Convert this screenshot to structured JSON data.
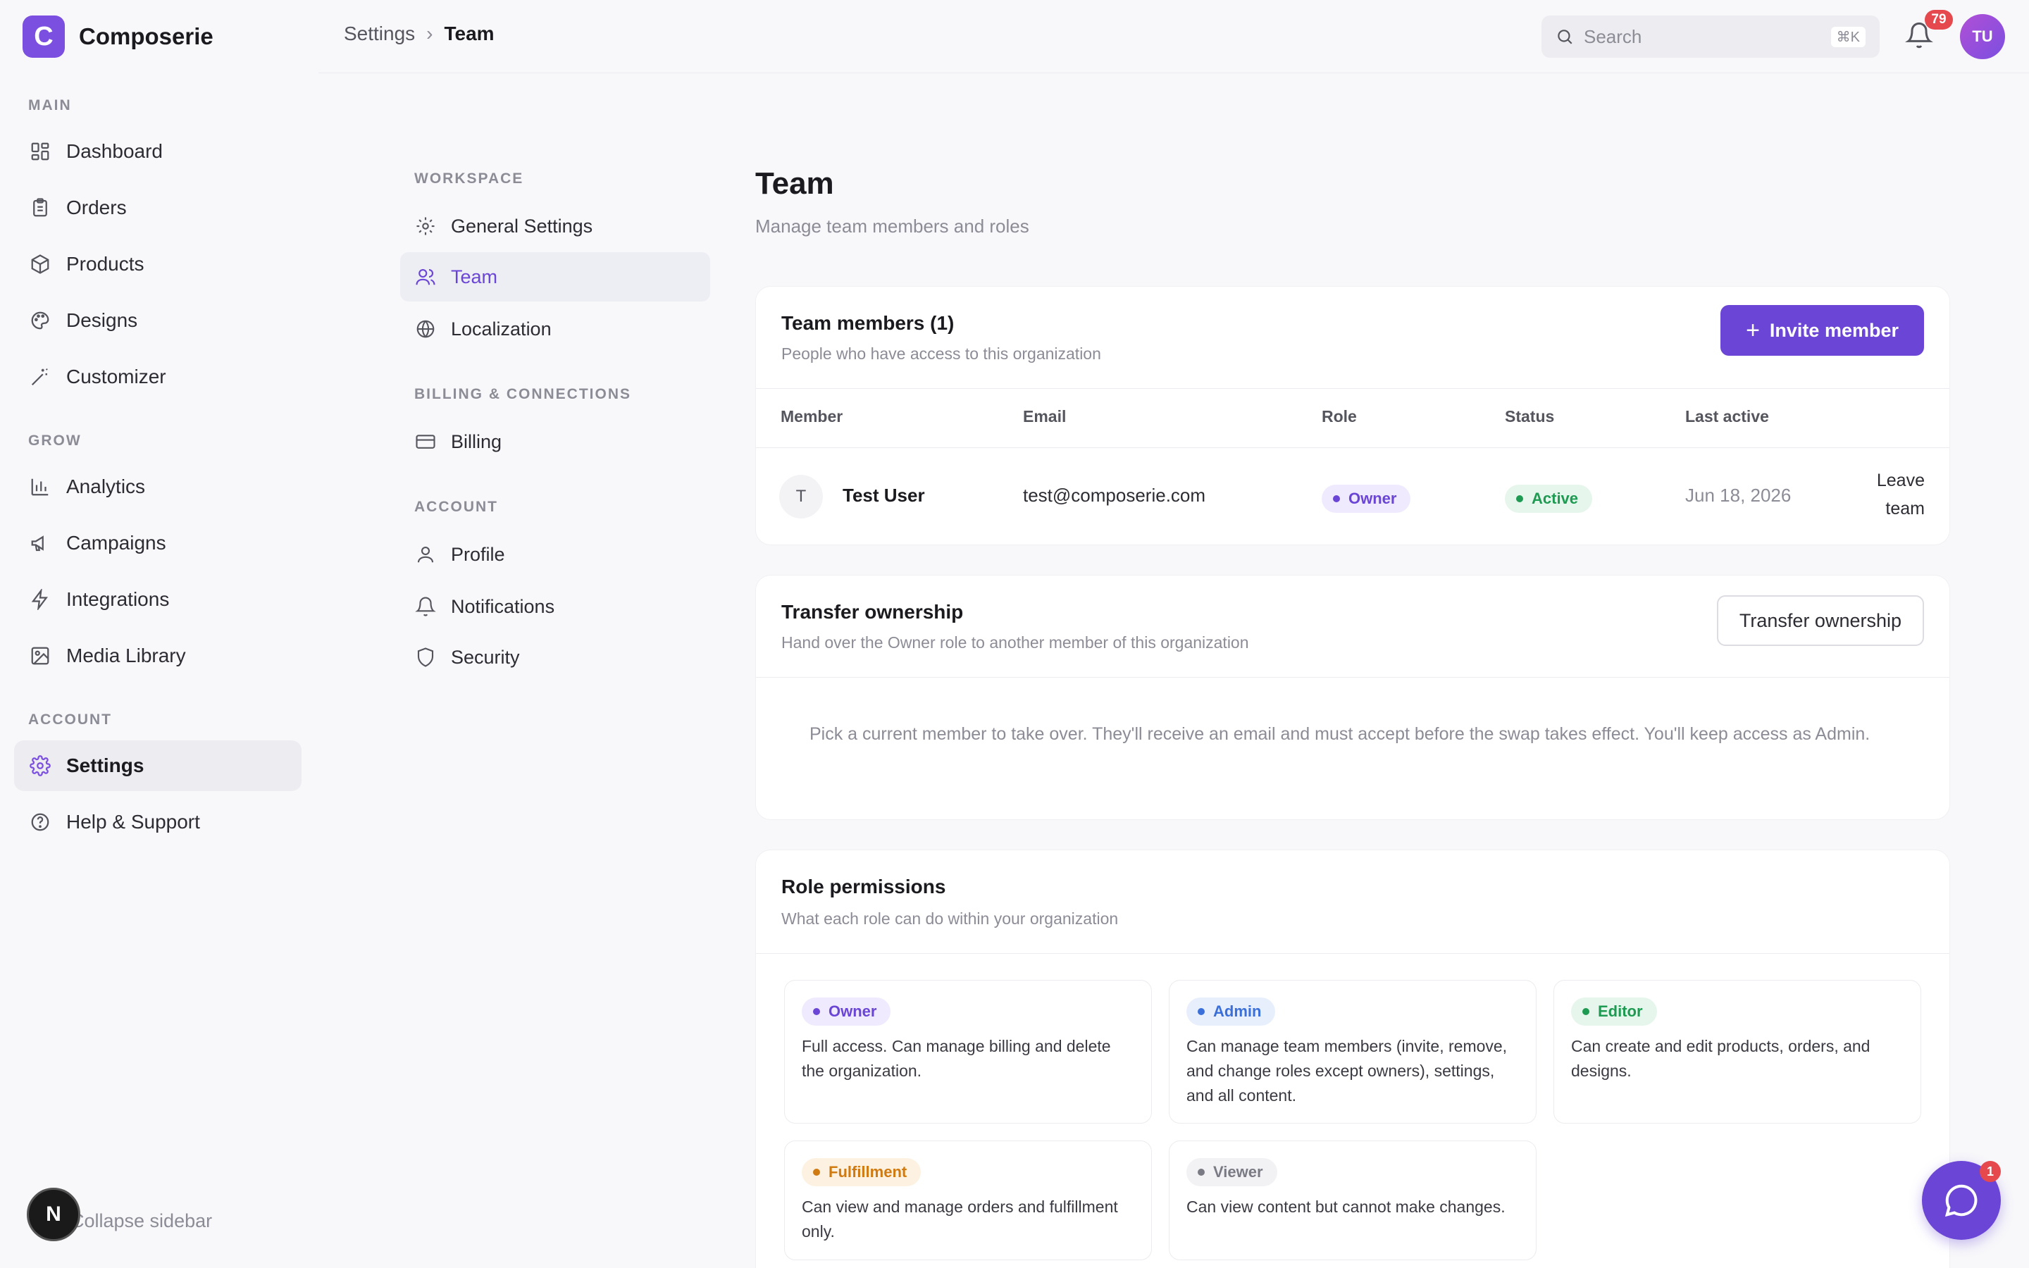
{
  "app": {
    "name": "Composerie",
    "logo_letter": "C"
  },
  "sidebar": {
    "sections": [
      {
        "label": "MAIN"
      },
      {
        "label": "GROW"
      },
      {
        "label": "ACCOUNT"
      }
    ],
    "items": [
      {
        "label": "Dashboard",
        "icon": "grid-icon"
      },
      {
        "label": "Orders",
        "icon": "clipboard-icon"
      },
      {
        "label": "Products",
        "icon": "box-icon"
      },
      {
        "label": "Designs",
        "icon": "palette-icon"
      },
      {
        "label": "Customizer",
        "icon": "wand-icon"
      },
      {
        "label": "Analytics",
        "icon": "bar-chart-icon"
      },
      {
        "label": "Campaigns",
        "icon": "megaphone-icon"
      },
      {
        "label": "Integrations",
        "icon": "bolt-icon"
      },
      {
        "label": "Media Library",
        "icon": "image-icon"
      },
      {
        "label": "Settings",
        "icon": "gear-icon",
        "active": true
      },
      {
        "label": "Help & Support",
        "icon": "help-icon"
      }
    ],
    "collapse_label": "Collapse sidebar",
    "n_badge": "N"
  },
  "topbar": {
    "breadcrumb": [
      "Settings",
      "Team"
    ],
    "search_placeholder": "Search",
    "search_shortcut": "⌘K",
    "notification_count": "79",
    "avatar_initials": "TU"
  },
  "settings_nav": {
    "sections": [
      {
        "label": "WORKSPACE"
      },
      {
        "label": "BILLING & CONNECTIONS"
      },
      {
        "label": "ACCOUNT"
      }
    ],
    "items": [
      {
        "label": "General Settings",
        "icon": "gear-icon"
      },
      {
        "label": "Team",
        "icon": "users-icon",
        "active": true
      },
      {
        "label": "Localization",
        "icon": "globe-icon"
      },
      {
        "label": "Billing",
        "icon": "credit-card-icon"
      },
      {
        "label": "Profile",
        "icon": "user-icon"
      },
      {
        "label": "Notifications",
        "icon": "bell-icon"
      },
      {
        "label": "Security",
        "icon": "shield-icon"
      }
    ]
  },
  "page": {
    "title": "Team",
    "subtitle": "Manage team members and roles"
  },
  "members_card": {
    "title": "Team members (1)",
    "subtitle": "People who have access to this organization",
    "invite_label": "Invite member",
    "columns": [
      "Member",
      "Email",
      "Role",
      "Status",
      "Last active"
    ],
    "rows": [
      {
        "initial": "T",
        "name": "Test User",
        "email": "test@composerie.com",
        "role": "Owner",
        "status": "Active",
        "last_active": "Jun 18, 2026",
        "action_line1": "Leave",
        "action_line2": "team"
      }
    ]
  },
  "transfer_card": {
    "title": "Transfer ownership",
    "subtitle": "Hand over the Owner role to another member of this organization",
    "button_label": "Transfer ownership",
    "body": "Pick a current member to take over. They'll receive an email and must accept before the swap takes effect. You'll keep access as Admin."
  },
  "roles_card": {
    "title": "Role permissions",
    "subtitle": "What each role can do within your organization",
    "roles": [
      {
        "name": "Owner",
        "color": "#6a45d6",
        "bg": "#efeafd",
        "desc": "Full access. Can manage billing and delete the organization."
      },
      {
        "name": "Admin",
        "color": "#3b6fd9",
        "bg": "#e8effc",
        "desc": "Can manage team members (invite, remove, and change roles except owners), settings, and all content."
      },
      {
        "name": "Editor",
        "color": "#1f9a52",
        "bg": "#e6f6ec",
        "desc": "Can create and edit products, orders, and designs."
      },
      {
        "name": "Fulfillment",
        "color": "#d07a12",
        "bg": "#fdf1e2",
        "desc": "Can view and manage orders and fulfillment only."
      },
      {
        "name": "Viewer",
        "color": "#7a7a84",
        "bg": "#f2f2f4",
        "desc": "Can view content but cannot make changes."
      }
    ]
  },
  "chat": {
    "badge": "1"
  },
  "colors": {
    "accent": "#6a45d6",
    "brand": "#7b4fe0",
    "danger": "#e5484d",
    "success": "#1f9a52"
  }
}
